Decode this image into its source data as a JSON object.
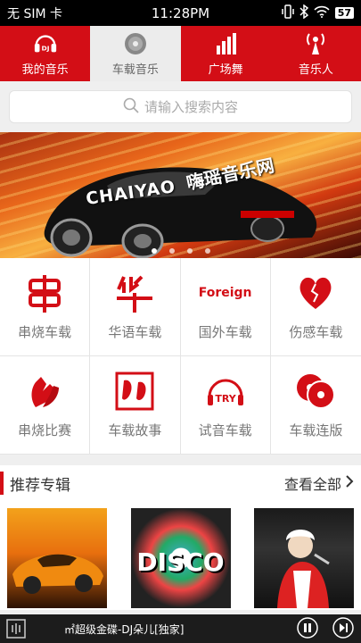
{
  "status": {
    "carrier": "无 SIM 卡",
    "time": "11:28PM",
    "battery": "57"
  },
  "tabs": [
    {
      "label": "我的音乐",
      "icon": "dj-headphone-icon",
      "active": false
    },
    {
      "label": "车载音乐",
      "icon": "cd-disc-icon",
      "active": true
    },
    {
      "label": "广场舞",
      "icon": "bar-chart-icon",
      "active": false
    },
    {
      "label": "音乐人",
      "icon": "antenna-person-icon",
      "active": false
    }
  ],
  "search": {
    "placeholder": "请输入搜索内容"
  },
  "banner": {
    "brand": "CHAIYAO",
    "title": "嗨瑶音乐网",
    "dots": 4,
    "active_dot": 0
  },
  "categories": [
    {
      "label": "串烧车载",
      "icon": "chuan-glyph-icon"
    },
    {
      "label": "华语车载",
      "icon": "hua-glyph-icon"
    },
    {
      "label": "国外车载",
      "icon": "foreign-text-icon",
      "icon_text": "Foreign"
    },
    {
      "label": "伤感车载",
      "icon": "broken-heart-icon"
    },
    {
      "label": "串烧比赛",
      "icon": "clapping-hands-icon"
    },
    {
      "label": "车载故事",
      "icon": "story-faces-icon"
    },
    {
      "label": "试音车载",
      "icon": "try-headphone-icon",
      "icon_text": "TRY"
    },
    {
      "label": "车载连版",
      "icon": "double-disc-icon"
    }
  ],
  "section": {
    "title": "推荐专辑",
    "view_all": "查看全部"
  },
  "albums": [
    {
      "name": "sports-car-album"
    },
    {
      "name": "disco-album",
      "text": "DISCO"
    },
    {
      "name": "singer-album"
    }
  ],
  "player": {
    "track": "㎡超级金碟-DJ朵儿[独家]"
  },
  "colors": {
    "brand_red": "#d30e16",
    "tab_active_bg": "#ececec",
    "page_bg": "#efefef"
  }
}
